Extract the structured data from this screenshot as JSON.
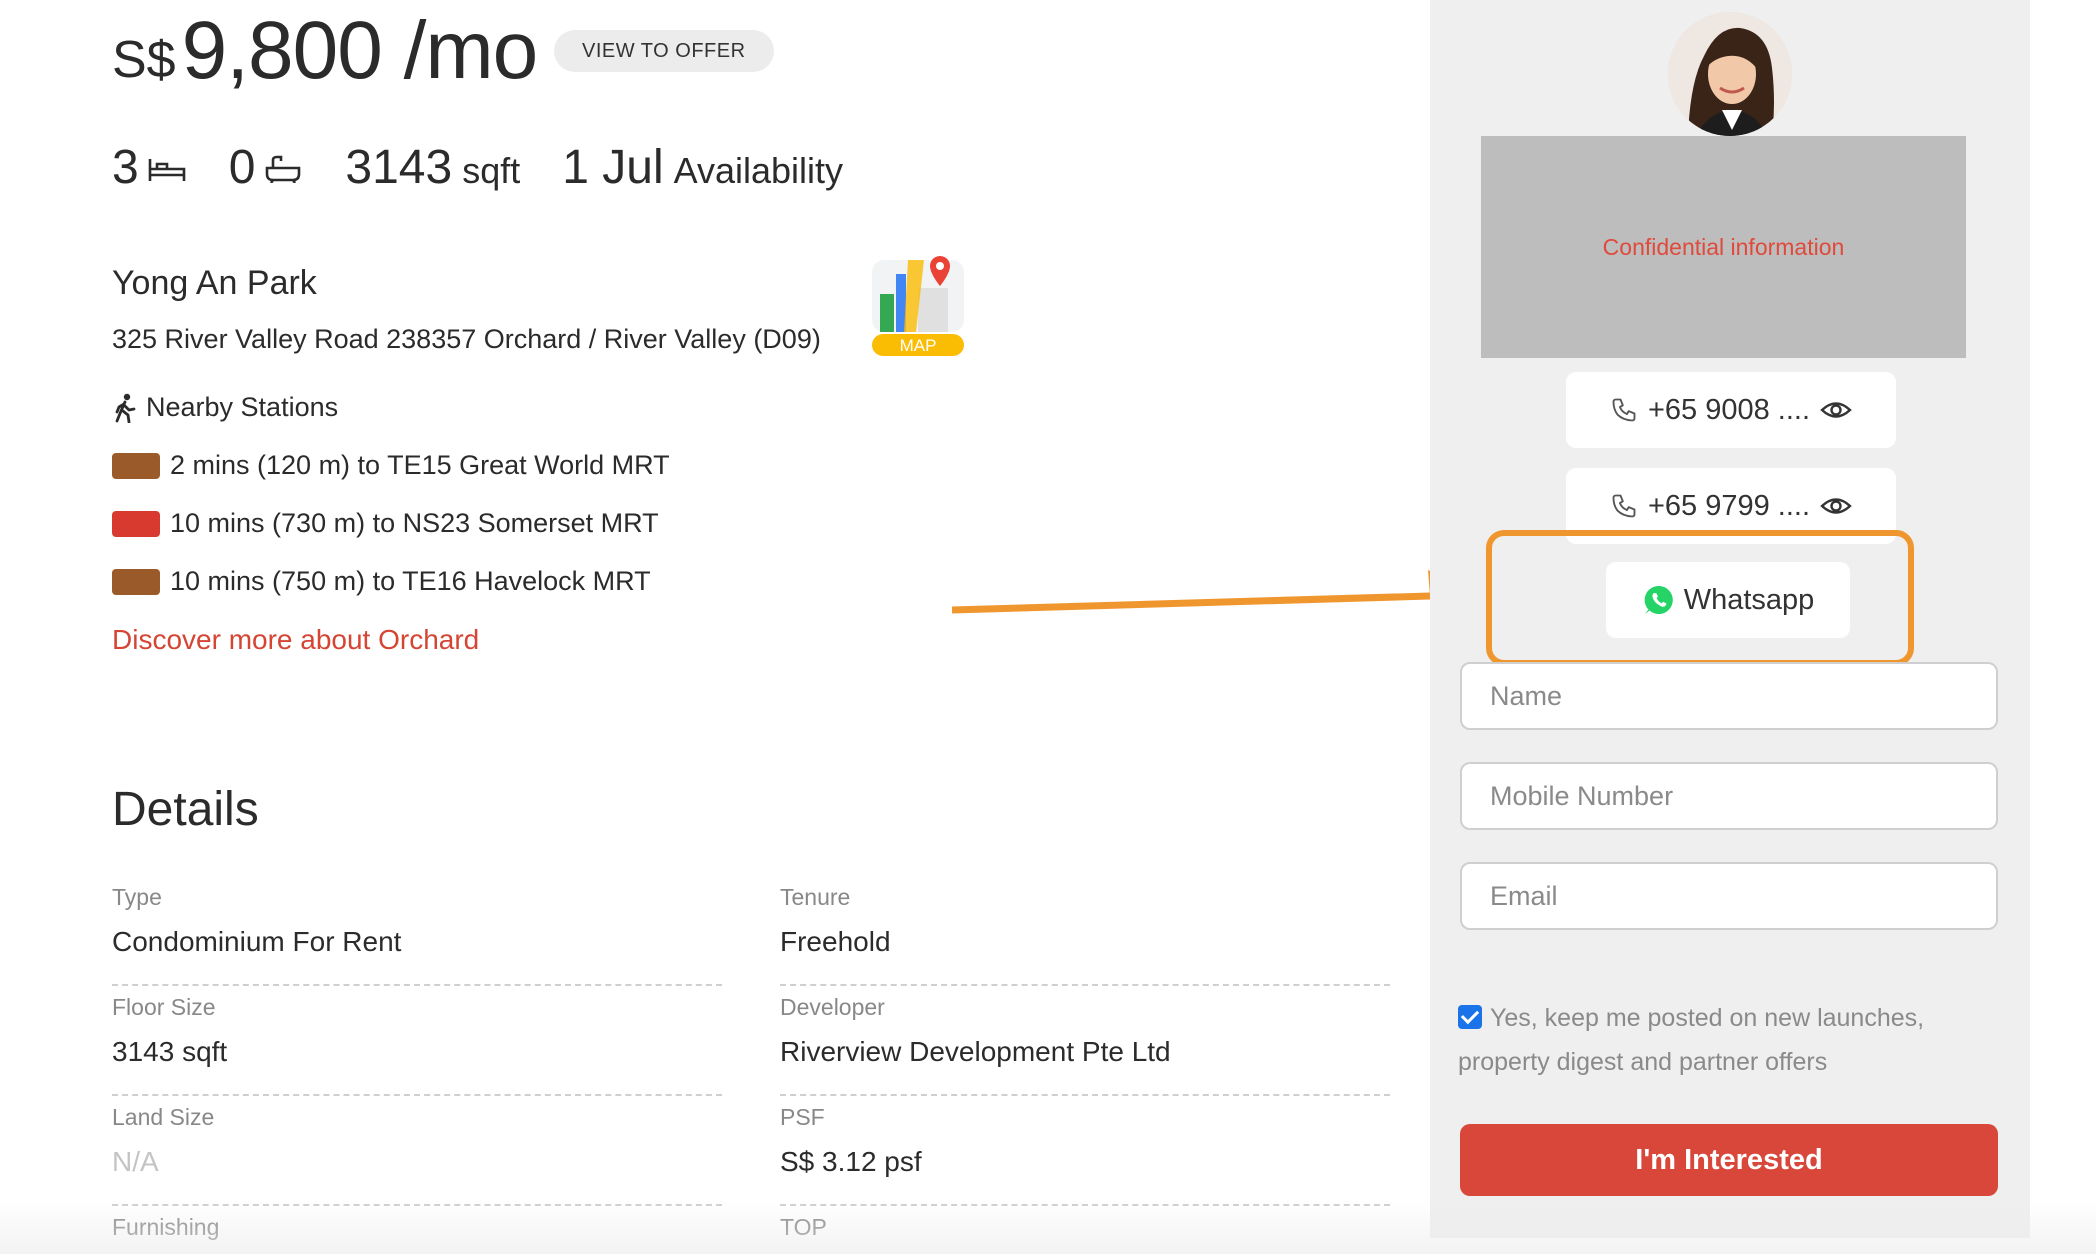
{
  "listing": {
    "currency": "S$",
    "price": "9,800 /mo",
    "offer_label": "VIEW TO OFFER",
    "bedrooms": "3",
    "bathrooms": "0",
    "size_value": "3143",
    "size_unit": "sqft",
    "availability_value": "1 Jul",
    "availability_label": "Availability",
    "project_name": "Yong An Park",
    "address": "325 River Valley Road 238357 Orchard / River Valley (D09)",
    "map_label": "MAP"
  },
  "nearby": {
    "title": "Nearby Stations",
    "stations": [
      {
        "text": "2 mins (120 m) to TE15 Great World MRT",
        "color": "#9b5a2a"
      },
      {
        "text": "10 mins (730 m) to NS23 Somerset MRT",
        "color": "#d93a2f"
      },
      {
        "text": "10 mins (750 m) to TE16 Havelock MRT",
        "color": "#9b5a2a"
      }
    ],
    "discover_link": "Discover more about Orchard"
  },
  "details": {
    "title": "Details",
    "cells": [
      {
        "label": "Type",
        "value": "Condominium For Rent"
      },
      {
        "label": "Tenure",
        "value": "Freehold"
      },
      {
        "label": "Floor Size",
        "value": "3143 sqft"
      },
      {
        "label": "Developer",
        "value": "Riverview Development Pte Ltd"
      },
      {
        "label": "Land Size",
        "value": "N/A"
      },
      {
        "label": "PSF",
        "value": "S$ 3.12 psf"
      },
      {
        "label": "Furnishing",
        "value": ""
      },
      {
        "label": "TOP",
        "value": ""
      }
    ]
  },
  "agent": {
    "confidential_text": "Confidential information",
    "phone_1": "+65 9008 ....",
    "phone_2": "+65 9799 ....",
    "whatsapp_label": "Whatsapp"
  },
  "form": {
    "name_placeholder": "Name",
    "mobile_placeholder": "Mobile Number",
    "email_placeholder": "Email",
    "consent_text": "Yes, keep me posted on new launches, property digest and partner offers",
    "consent_checked": true,
    "submit_label": "I'm Interested"
  },
  "colors": {
    "accent_red": "#d9473a",
    "highlight_orange": "#f0962e",
    "whatsapp_green": "#25d366"
  }
}
